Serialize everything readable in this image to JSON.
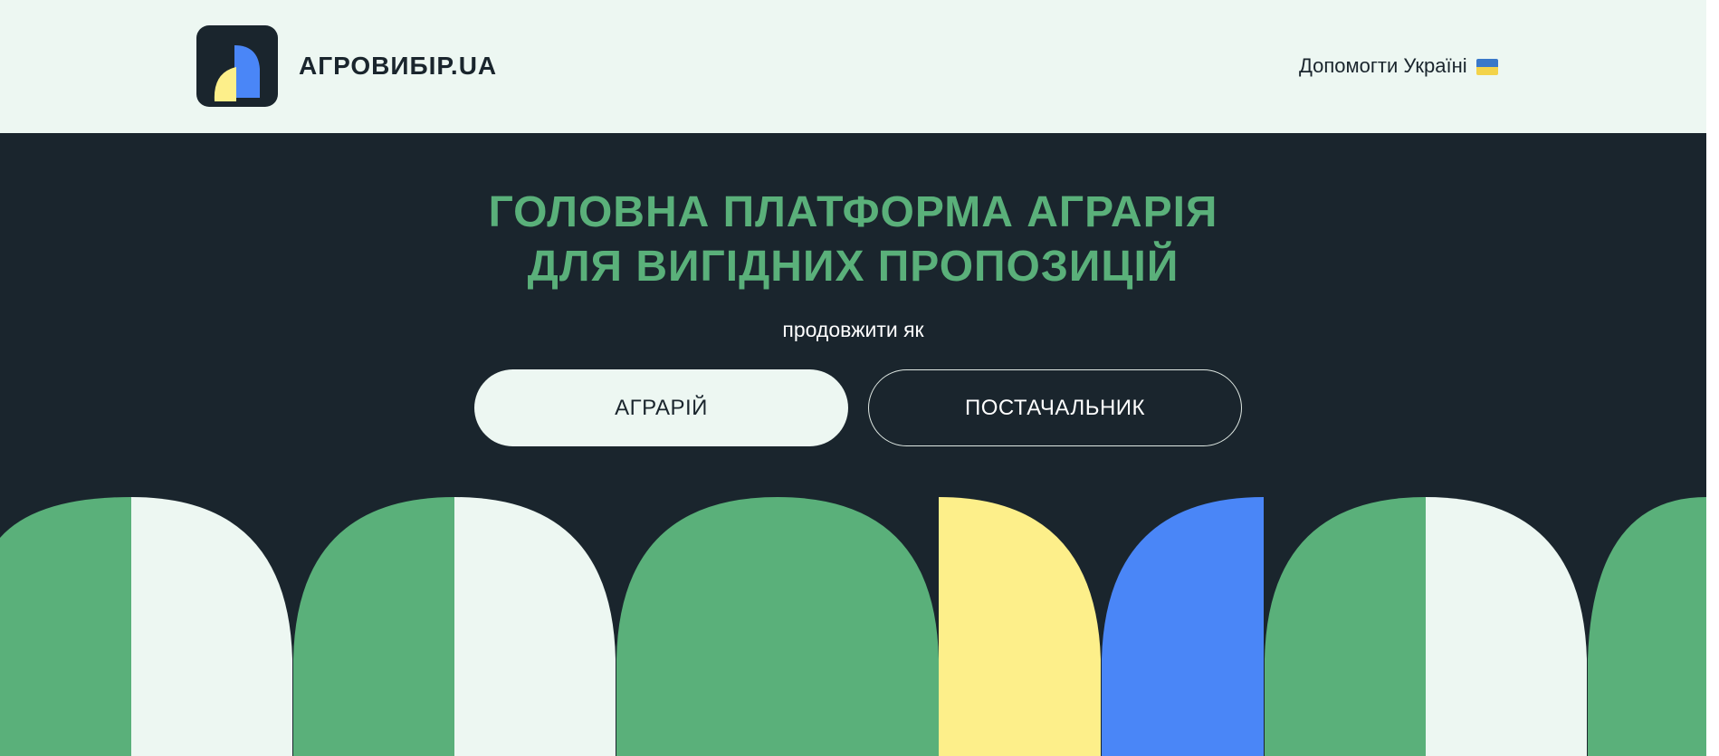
{
  "header": {
    "brand": "АГРОВИБІР.UA",
    "help_link": "Допомогти Україні",
    "flag_icon": "ukraine-flag-icon",
    "logo_icon": "agrovybir-logo-icon"
  },
  "hero": {
    "headline_line1": "ГОЛОВНА ПЛАТФОРМА АГРАРІЯ",
    "headline_line2": "ДЛЯ ВИГІДНИХ ПРОПОЗИЦІЙ",
    "subtitle": "продовжити як",
    "buttons": {
      "farmer": "АГРАРІЙ",
      "supplier": "ПОСТАЧАЛЬНИК"
    }
  },
  "colors": {
    "background_dark": "#1a252d",
    "header_bg": "#edf7f2",
    "accent_green": "#5ab07a",
    "accent_yellow": "#fdef8a",
    "accent_blue": "#4a86f7",
    "mint": "#edf7f2"
  }
}
